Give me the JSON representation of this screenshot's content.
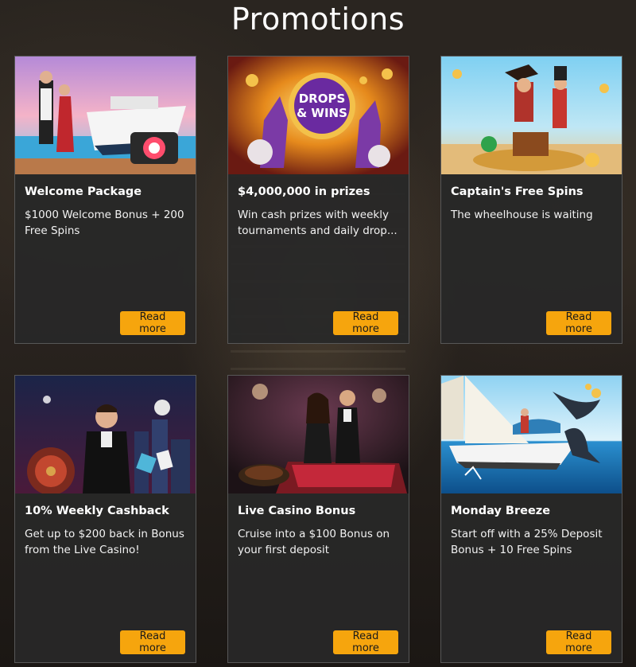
{
  "page": {
    "title": "Promotions"
  },
  "promotions": [
    {
      "title": "Welcome Package",
      "description": "$1000 Welcome Bonus + 200 Free Spins",
      "button": "Read more",
      "image": "cruise-ship-couple-image"
    },
    {
      "title": "$4,000,000 in prizes",
      "description": "Win cash prizes with weekly tournaments and daily drop...",
      "button": "Read more",
      "image": "drops-and-wins-image",
      "image_text": {
        "line1": "DROPS",
        "line2": "& WINS"
      }
    },
    {
      "title": "Captain's Free Spins",
      "description": "The wheelhouse is waiting",
      "button": "Read more",
      "image": "pirate-captain-treasure-image"
    },
    {
      "title": "10% Weekly Cashback",
      "description": "Get up to $200 back in Bonus from the Live Casino!",
      "button": "Read more",
      "image": "casino-man-tuxedo-image"
    },
    {
      "title": "Live Casino Bonus",
      "description": "Cruise into a $100 Bonus on your first deposit",
      "button": "Read more",
      "image": "live-casino-roulette-image"
    },
    {
      "title": "Monday Breeze",
      "description": "Start off with a 25% Deposit Bonus + 10 Free Spins",
      "button": "Read more",
      "image": "sailboat-whale-image"
    }
  ],
  "colors": {
    "button": "#f6a50d",
    "card": "#282828",
    "border": "#575757",
    "title": "#ffffff"
  }
}
